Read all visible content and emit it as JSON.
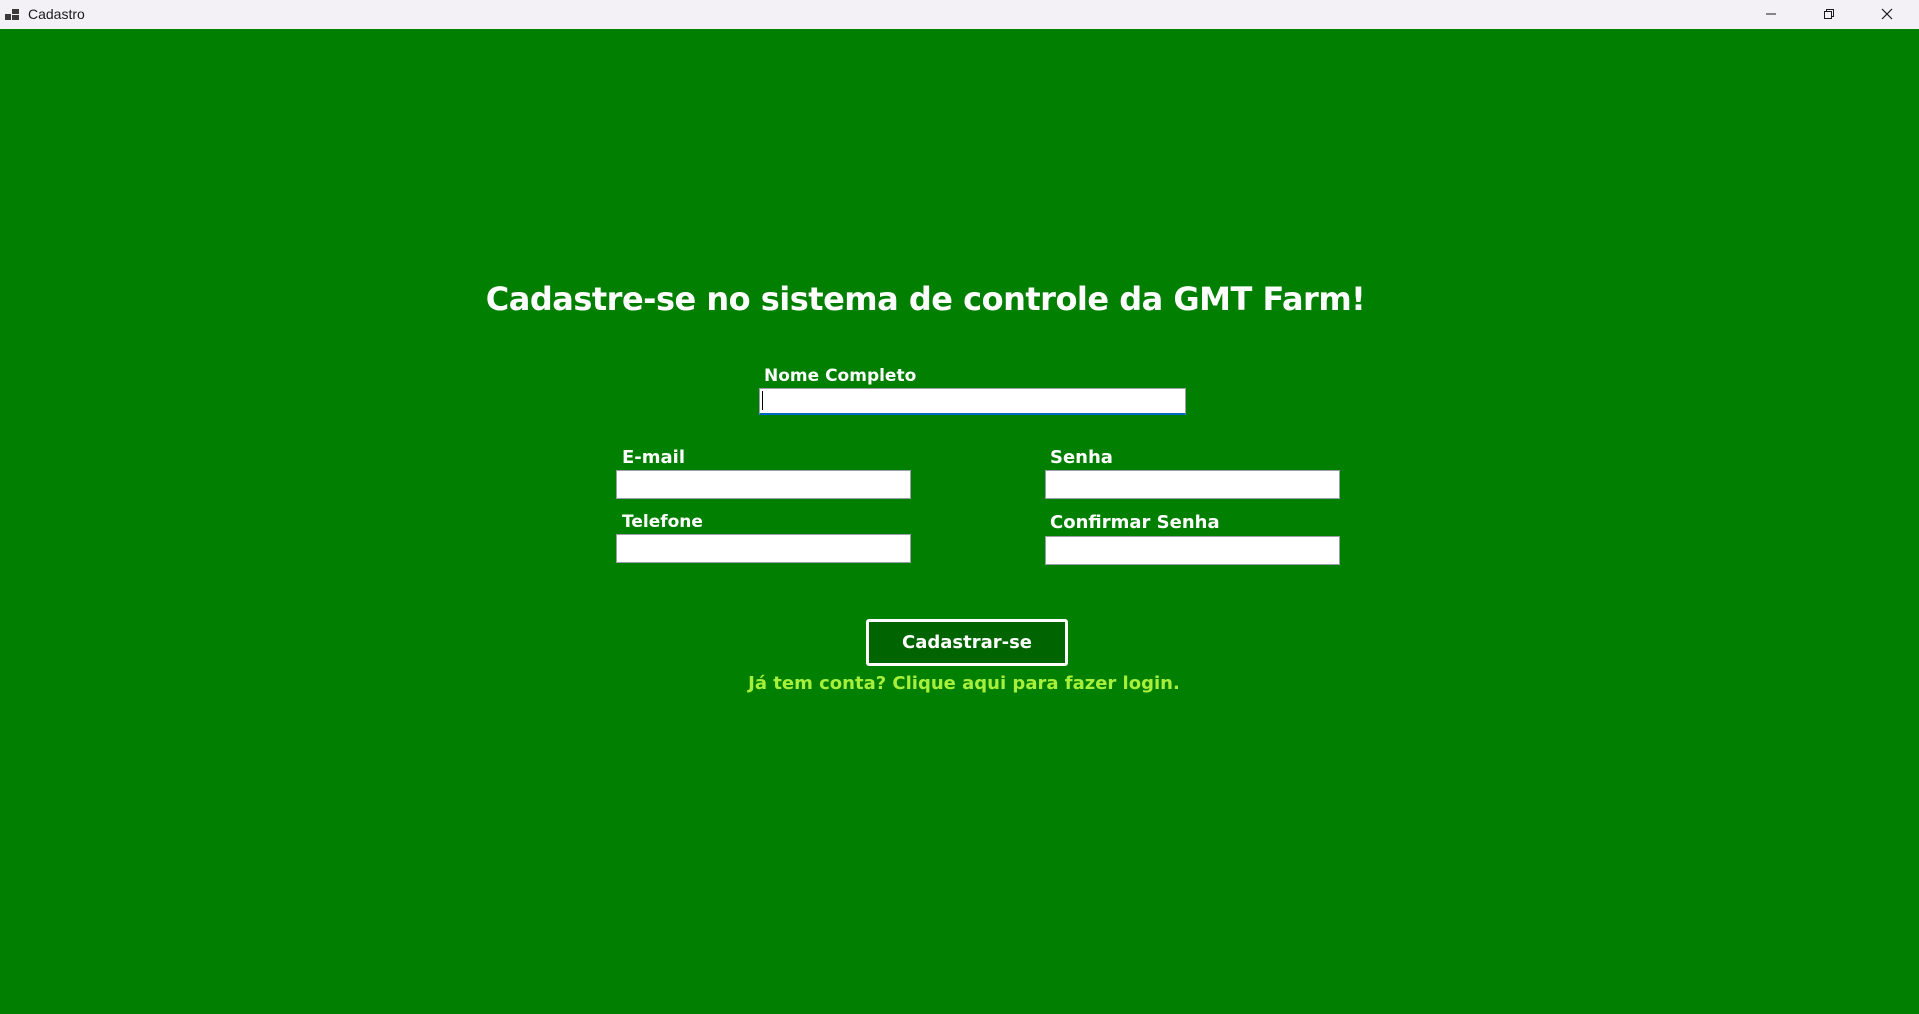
{
  "window": {
    "title": "Cadastro",
    "icon": "app-window-icon",
    "controls": {
      "minimize_icon": "minimize-icon",
      "maximize_icon": "restore-icon",
      "close_icon": "close-icon"
    }
  },
  "form": {
    "heading": "Cadastre-se no sistema de controle da GMT Farm!",
    "fields": {
      "nome": {
        "label": "Nome Completo",
        "value": "",
        "placeholder": ""
      },
      "email": {
        "label": "E-mail",
        "value": "",
        "placeholder": ""
      },
      "telefone": {
        "label": "Telefone",
        "value": "",
        "placeholder": ""
      },
      "senha": {
        "label": "Senha",
        "value": "",
        "placeholder": ""
      },
      "confirmar_senha": {
        "label": "Confirmar Senha",
        "value": "",
        "placeholder": ""
      }
    },
    "submit_label": "Cadastrar-se",
    "login_link": "Já tem conta? Clique aqui para fazer login."
  },
  "colors": {
    "background": "#007f00",
    "button_background": "#006400",
    "link": "#a6f03c",
    "text": "#ffffff"
  }
}
